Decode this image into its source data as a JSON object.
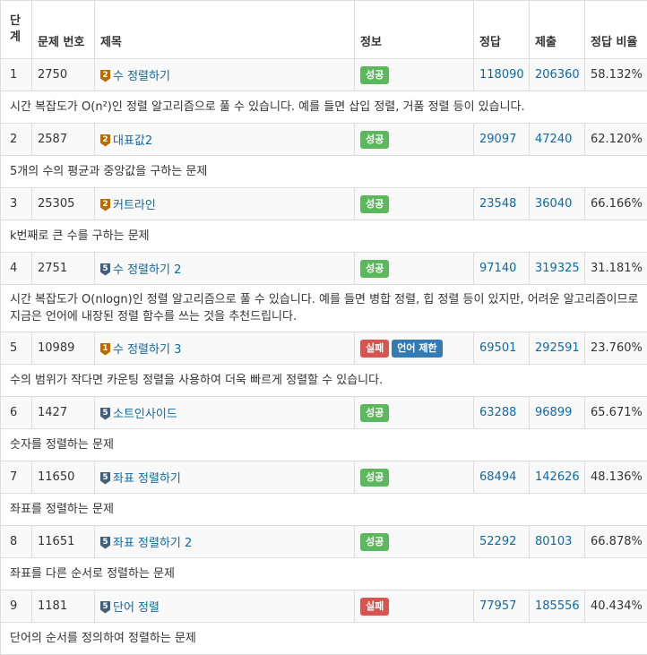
{
  "headers": {
    "level": "단계",
    "id": "문제 번호",
    "title": "제목",
    "info": "정보",
    "correct": "정답",
    "submit": "제출",
    "ratio": "정답 비율"
  },
  "rows": [
    {
      "level": "1",
      "id": "2750",
      "tier": "2",
      "tierColor": "#b86b00",
      "title": "수 정렬하기",
      "badges": [
        {
          "text": "성공",
          "kind": "ok"
        }
      ],
      "correct": "118090",
      "submit": "206360",
      "ratio": "58.132%",
      "desc": "시간 복잡도가 O(n²)인 정렬 알고리즘으로 풀 수 있습니다. 예를 들면 삽입 정렬, 거품 정렬 등이 있습니다."
    },
    {
      "level": "2",
      "id": "2587",
      "tier": "2",
      "tierColor": "#b86b00",
      "title": "대표값2",
      "badges": [
        {
          "text": "성공",
          "kind": "ok"
        }
      ],
      "correct": "29097",
      "submit": "47240",
      "ratio": "62.120%",
      "desc": "5개의 수의 평균과 중앙값을 구하는 문제"
    },
    {
      "level": "3",
      "id": "25305",
      "tier": "2",
      "tierColor": "#b86b00",
      "title": "커트라인",
      "badges": [
        {
          "text": "성공",
          "kind": "ok"
        }
      ],
      "correct": "23548",
      "submit": "36040",
      "ratio": "66.166%",
      "desc": "k번째로 큰 수를 구하는 문제"
    },
    {
      "level": "4",
      "id": "2751",
      "tier": "5",
      "tierColor": "#435f7a",
      "title": "수 정렬하기 2",
      "badges": [
        {
          "text": "성공",
          "kind": "ok"
        }
      ],
      "correct": "97140",
      "submit": "319325",
      "ratio": "31.181%",
      "desc": "시간 복잡도가 O(nlogn)인 정렬 알고리즘으로 풀 수 있습니다. 예를 들면 병합 정렬, 힙 정렬 등이 있지만, 어려운 알고리즘이므로 지금은 언어에 내장된 정렬 함수를 쓰는 것을 추천드립니다.",
      "tall": true
    },
    {
      "level": "5",
      "id": "10989",
      "tier": "1",
      "tierColor": "#b86b00",
      "title": "수 정렬하기 3",
      "badges": [
        {
          "text": "실패",
          "kind": "fail"
        },
        {
          "text": "언어 제한",
          "kind": "lang"
        }
      ],
      "correct": "69501",
      "submit": "292591",
      "ratio": "23.760%",
      "desc": "수의 범위가 작다면 카운팅 정렬을 사용하여 더욱 빠르게 정렬할 수 있습니다."
    },
    {
      "level": "6",
      "id": "1427",
      "tier": "5",
      "tierColor": "#435f7a",
      "title": "소트인사이드",
      "badges": [
        {
          "text": "성공",
          "kind": "ok"
        }
      ],
      "correct": "63288",
      "submit": "96899",
      "ratio": "65.671%",
      "desc": "숫자를 정렬하는 문제"
    },
    {
      "level": "7",
      "id": "11650",
      "tier": "5",
      "tierColor": "#435f7a",
      "title": "좌표 정렬하기",
      "badges": [
        {
          "text": "성공",
          "kind": "ok"
        }
      ],
      "correct": "68494",
      "submit": "142626",
      "ratio": "48.136%",
      "desc": "좌표를 정렬하는 문제"
    },
    {
      "level": "8",
      "id": "11651",
      "tier": "5",
      "tierColor": "#435f7a",
      "title": "좌표 정렬하기 2",
      "badges": [
        {
          "text": "성공",
          "kind": "ok"
        }
      ],
      "correct": "52292",
      "submit": "80103",
      "ratio": "66.878%",
      "desc": "좌표를 다른 순서로 정렬하는 문제"
    },
    {
      "level": "9",
      "id": "1181",
      "tier": "5",
      "tierColor": "#435f7a",
      "title": "단어 정렬",
      "badges": [
        {
          "text": "실패",
          "kind": "fail"
        }
      ],
      "correct": "77957",
      "submit": "185556",
      "ratio": "40.434%",
      "desc": "단어의 순서를 정의하여 정렬하는 문제"
    }
  ]
}
